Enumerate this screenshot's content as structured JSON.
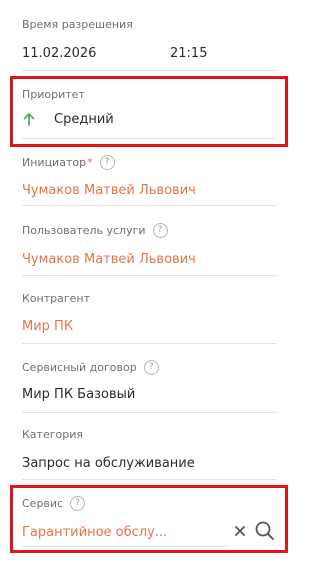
{
  "resolution": {
    "label": "Время разрешения",
    "date": "11.02.2026",
    "time": "21:15"
  },
  "priority": {
    "label": "Приоритет",
    "value": "Средний",
    "icon": "arrow-up-icon",
    "icon_color": "#4caf50"
  },
  "initiator": {
    "label": "Инициатор",
    "required_mark": "*",
    "value": "Чумаков Матвей Львович"
  },
  "service_user": {
    "label": "Пользователь услуги",
    "value": "Чумаков Матвей Львович"
  },
  "counterparty": {
    "label": "Контрагент",
    "value": "Мир ПК"
  },
  "contract": {
    "label": "Сервисный договор",
    "value": "Мир ПК Базовый"
  },
  "category": {
    "label": "Категория",
    "value": "Запрос на обслуживание"
  },
  "service": {
    "label": "Сервис",
    "value": "Гарантийное обслу...",
    "clear_icon": "close-icon",
    "search_icon": "search-icon"
  },
  "help_glyph": "?",
  "colors": {
    "link": "#e8734a",
    "highlight": "#e0141c"
  }
}
